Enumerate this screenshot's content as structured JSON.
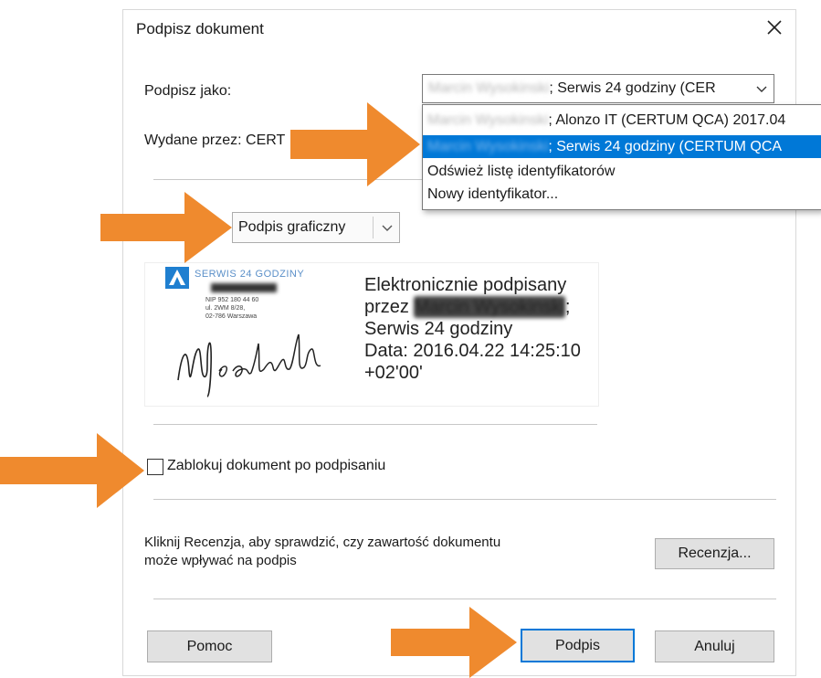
{
  "dialog": {
    "title": "Podpisz dokument",
    "close_glyph": "✕"
  },
  "sign_as": {
    "label": "Podpisz jako:",
    "selected_visible": "; Serwis 24 godziny (CER",
    "blurred_prefix": "Marcin Wysokinski"
  },
  "issued_by": {
    "label": "Wydane przez: CERT"
  },
  "dropdown": {
    "items": [
      {
        "blurred": "Marcin Wysokinski",
        "visible": "; Alonzo IT (CERTUM QCA) 2017.04"
      },
      {
        "blurred": "Marcin Wysokinski",
        "visible": "; Serwis 24 godziny (CERTUM QCA"
      },
      {
        "visible": "Odśwież listę identyfikatorów"
      },
      {
        "visible": "Nowy identyfikator..."
      }
    ]
  },
  "signature_type": {
    "selected": "Podpis graficzny"
  },
  "preview": {
    "logo_text": "SERWIS 24 GODZINY",
    "stamp_lines": [
      "NIP 952 180 44 60",
      "ul. 2WM 8/28,",
      "02-786 Warszawa"
    ],
    "handwriting": "M.sokinski",
    "line1": "Elektronicznie podpisany",
    "line2_prefix": "przez ",
    "line2_blurred": "Marcin Wysokinski",
    "line2_suffix": ";",
    "line3": "Serwis 24 godziny",
    "line4": "Data: 2016.04.22 14:25:10",
    "line5": "+02'00'"
  },
  "lock": {
    "label": "Zablokuj dokument po podpisaniu",
    "checked": false
  },
  "review": {
    "text_line1": "Kliknij Recenzja, aby sprawdzić, czy zawartość dokumentu",
    "text_line2": "może wpływać na podpis",
    "button": "Recenzja..."
  },
  "buttons": {
    "help": "Pomoc",
    "sign": "Podpis",
    "cancel": "Anuluj"
  },
  "colors": {
    "accent": "#0078d7",
    "arrow": "#ef8a2e"
  }
}
